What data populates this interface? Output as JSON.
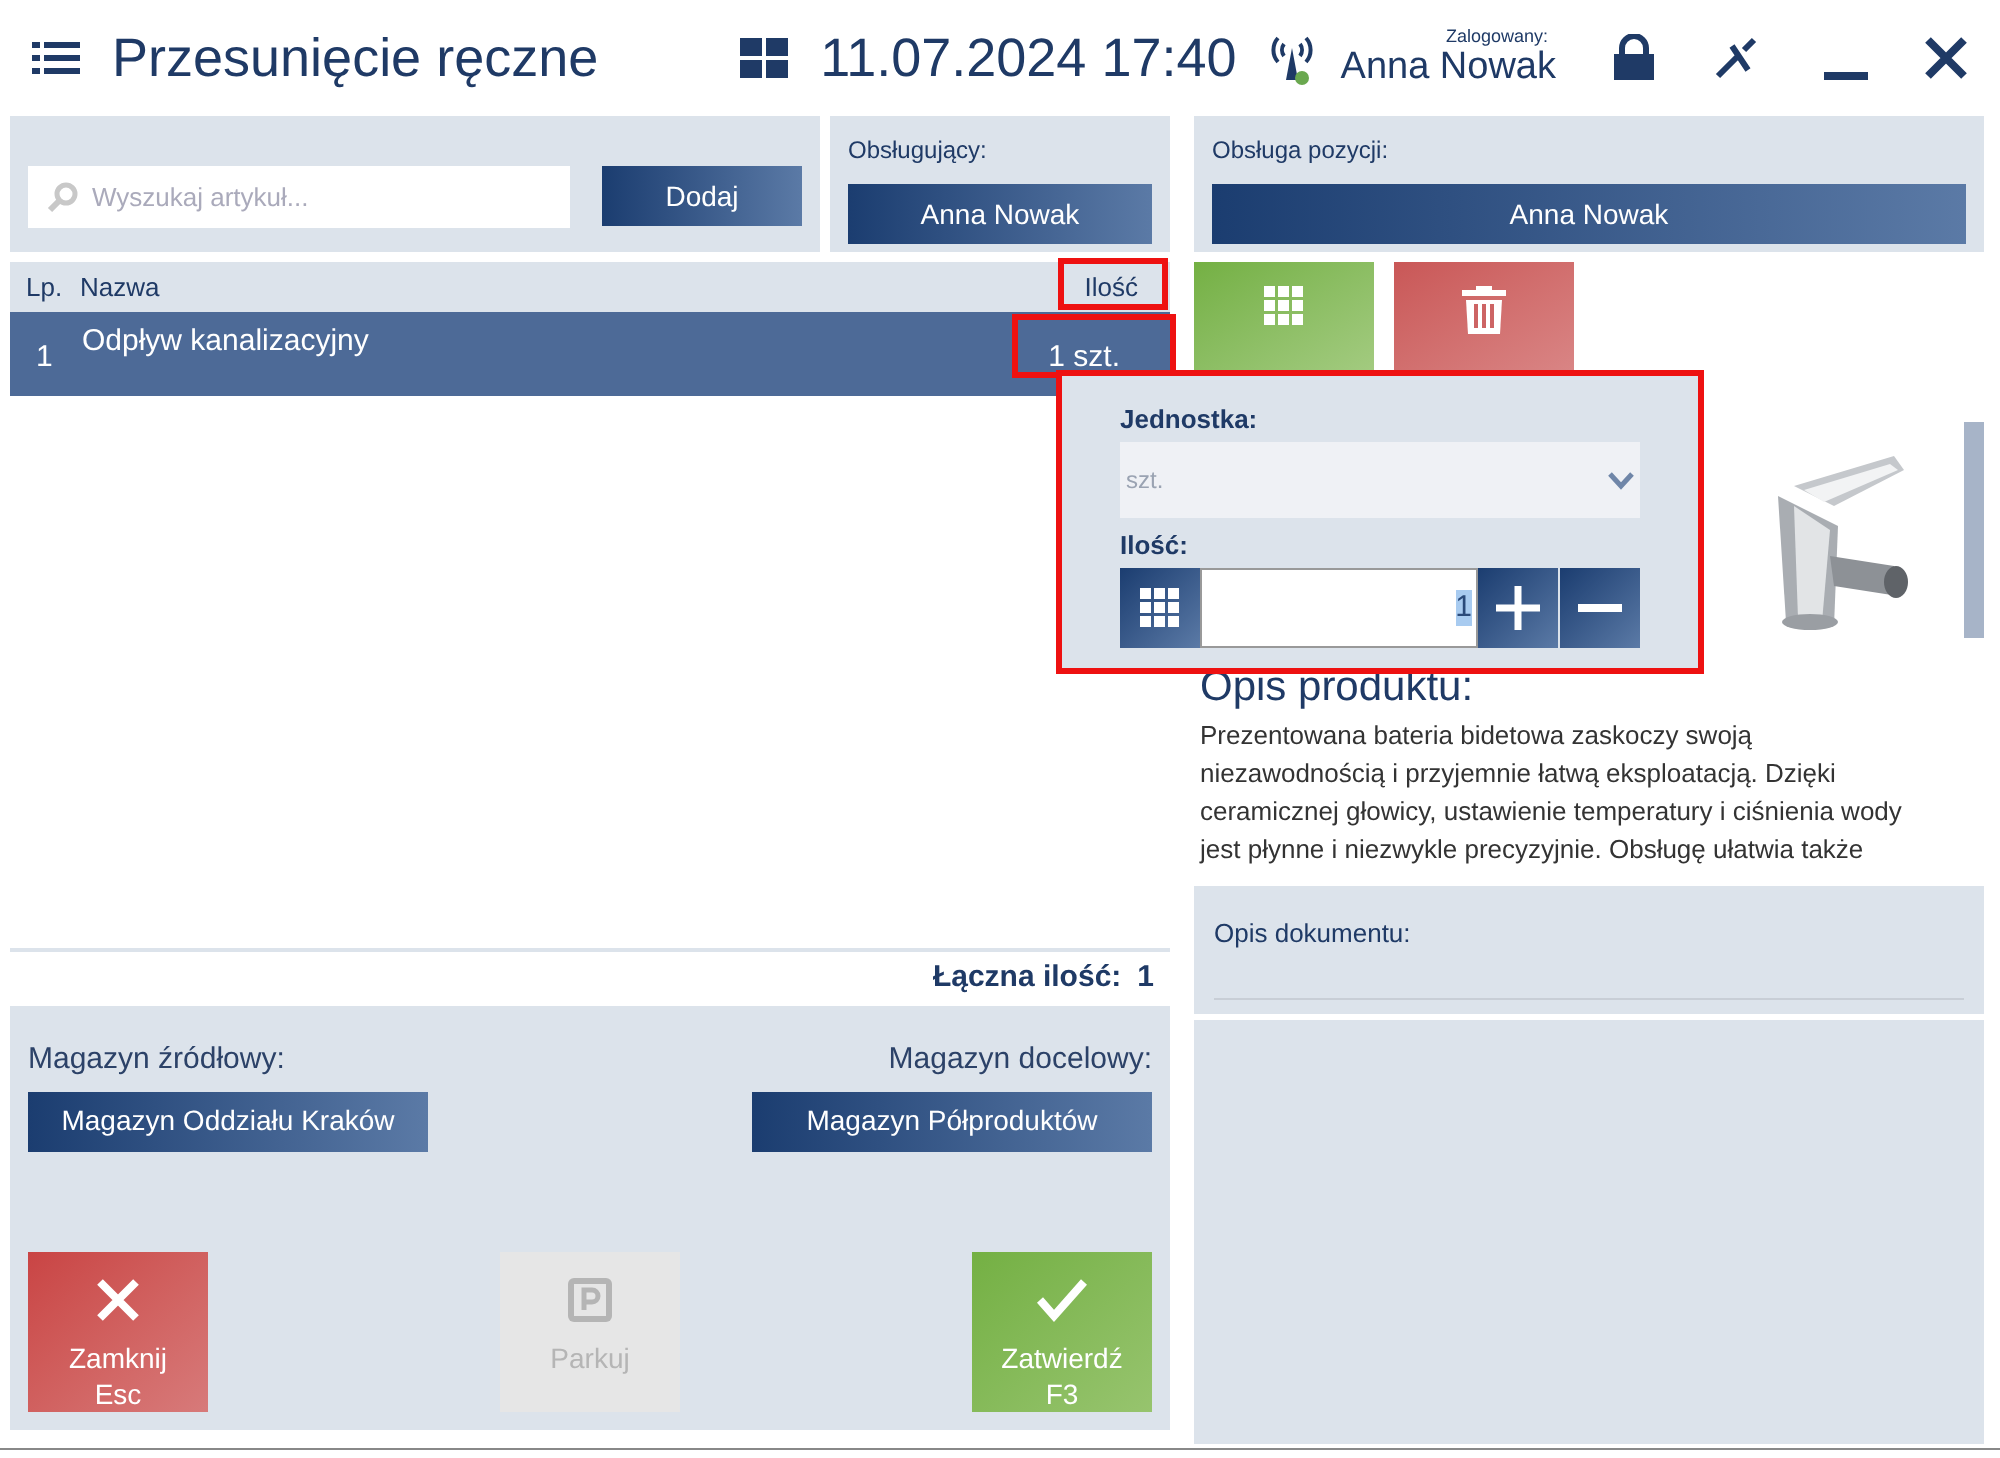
{
  "header": {
    "title": "Przesunięcie ręczne",
    "datetime": "11.07.2024 17:40",
    "logged_label": "Zalogowany:",
    "user": "Anna Nowak"
  },
  "search": {
    "placeholder": "Wyszukaj artykuł...",
    "add_button": "Dodaj"
  },
  "operator": {
    "label": "Obsługujący:",
    "value": "Anna Nowak"
  },
  "item_operator": {
    "label": "Obsługa pozycji:",
    "value": "Anna Nowak"
  },
  "table": {
    "columns": [
      "Lp.",
      "Nazwa",
      "Ilość"
    ],
    "rows": [
      {
        "lp": "1",
        "name": "Odpływ kanalizacyjny",
        "qty": "1 szt.",
        "selected": true
      }
    ]
  },
  "total": {
    "label": "Łączna ilość:",
    "value": "1"
  },
  "source": {
    "label": "Magazyn źródłowy:",
    "value": "Magazyn Oddziału Kraków"
  },
  "target": {
    "label": "Magazyn docelowy:",
    "value": "Magazyn Półproduktów"
  },
  "actions": [
    {
      "kind": "close",
      "label": "Zamknij",
      "key": "Esc",
      "disabled": false
    },
    {
      "kind": "park",
      "label": "Parkuj",
      "disabled": true
    },
    {
      "kind": "confirm",
      "label": "Zatwierdź",
      "key": "F3",
      "disabled": false
    }
  ],
  "popup": {
    "unit_label": "Jednostka:",
    "unit_value": "szt.",
    "qty_label": "Ilość:",
    "qty_value": "1"
  },
  "product": {
    "heading": "Opis produktu:",
    "description": "Prezentowana bateria bidetowa zaskoczy swoją niezawodnością i przyjemnie łatwą eksploatacją. Dzięki ceramicznej głowicy, ustawienie temperatury i ciśnienia wody jest płynne i niezwykle precyzyjnie. Obsługę ułatwia także"
  },
  "document": {
    "label": "Opis dokumentu:"
  }
}
